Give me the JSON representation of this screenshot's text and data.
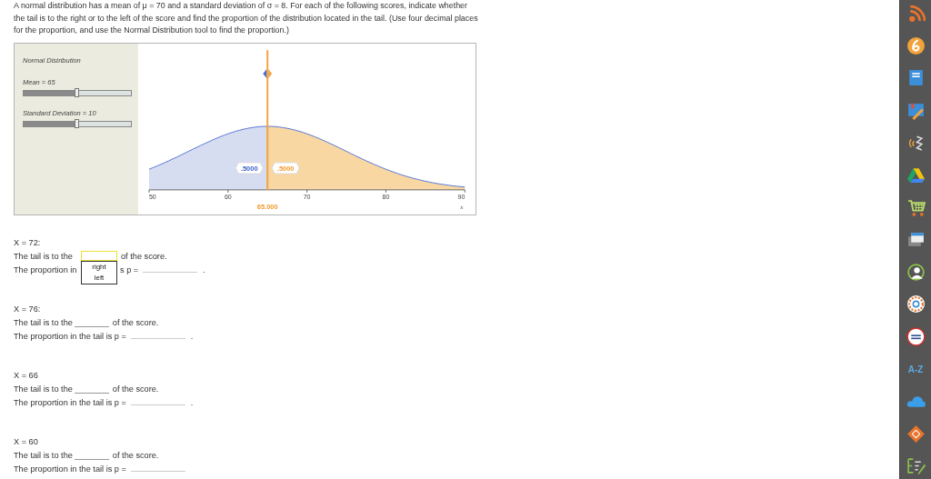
{
  "intro": "A normal distribution has a mean of μ = 70 and a standard deviation of σ = 8. For each of the following scores, indicate whether the tail is to the right or to the left of the score and find the proportion of the distribution located in the tail. (Use four decimal places for the proportion, and use the Normal Distribution tool to find the proportion.)",
  "tool": {
    "title": "Normal Distribution",
    "sliders": [
      {
        "label": "Mean = 65",
        "level": 0.5
      },
      {
        "label": "Standard Deviation = 10",
        "level": 0.5
      }
    ],
    "left_area": ".5000",
    "right_area": ".5000",
    "marker_value": "65.000",
    "x_ticks": [
      "50",
      "60",
      "70",
      "80",
      "90"
    ],
    "x_label": "x"
  },
  "questions": [
    {
      "score": "X = 72:",
      "tail_prompt": "The tail is to the",
      "tail_suffix": "of the score.",
      "tail_focused": true,
      "tail_open": true,
      "tail_options": [
        {
          "label": "right",
          "selected": false
        },
        {
          "label": "left",
          "selected": false
        }
      ],
      "proportion_parts": [
        "The proportion in",
        "s p ="
      ],
      "end_mark": "."
    },
    {
      "score": "X = 76:",
      "tail_prompt": "The tail is to the",
      "tail_suffix": "of the score.",
      "tail_focused": false,
      "tail_open": false,
      "proportion_parts": [
        "The proportion in the tail is p ="
      ],
      "end_mark": "."
    },
    {
      "score": "X = 66",
      "tail_prompt": "The tail is to the",
      "tail_suffix": "of the score.",
      "tail_focused": false,
      "tail_open": false,
      "proportion_parts": [
        "The proportion in the tail is p ="
      ],
      "end_mark": "."
    },
    {
      "score": "X = 60",
      "tail_prompt": "The tail is to the",
      "tail_suffix": "of the score.",
      "tail_focused": false,
      "tail_open": false,
      "proportion_parts": [
        "The proportion in the tail is p ="
      ]
    }
  ],
  "sidebar": [
    {
      "kind": "feed"
    },
    {
      "kind": "six"
    },
    {
      "kind": "book"
    },
    {
      "kind": "crayon"
    },
    {
      "kind": "wave"
    },
    {
      "kind": "drive"
    },
    {
      "kind": "cart"
    },
    {
      "kind": "windows"
    },
    {
      "kind": "person"
    },
    {
      "kind": "ring"
    },
    {
      "kind": "seal"
    },
    {
      "kind": "az",
      "label": "A-Z"
    },
    {
      "kind": "cloud"
    },
    {
      "kind": "diamond"
    },
    {
      "kind": "editor"
    }
  ]
}
